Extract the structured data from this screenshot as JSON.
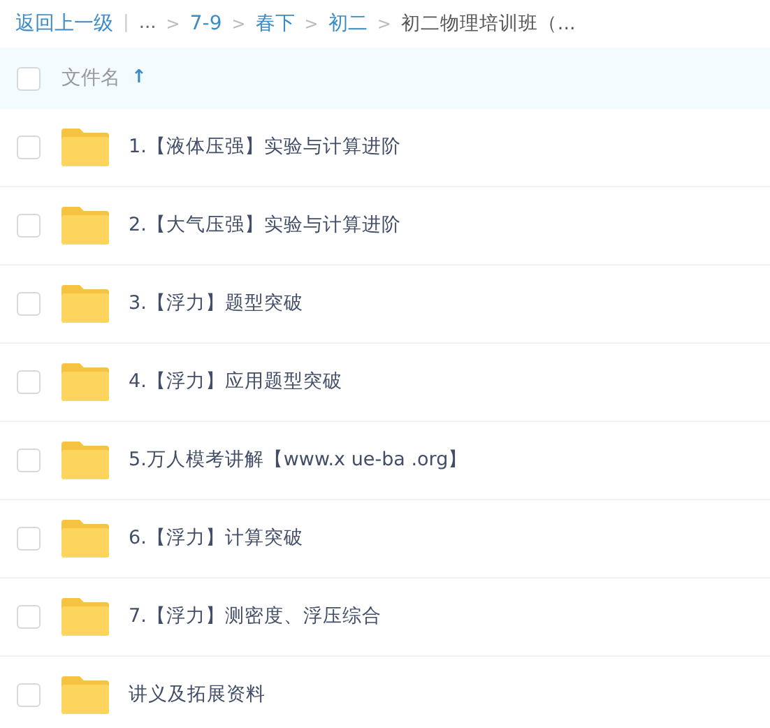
{
  "breadcrumb": [
    {
      "kind": "link",
      "label": "返回上一级"
    },
    {
      "kind": "divider",
      "label": "|"
    },
    {
      "kind": "text",
      "label": "..."
    },
    {
      "kind": "separator",
      "label": ">"
    },
    {
      "kind": "link",
      "label": "7-9"
    },
    {
      "kind": "separator",
      "label": ">"
    },
    {
      "kind": "link",
      "label": "春下"
    },
    {
      "kind": "separator",
      "label": ">"
    },
    {
      "kind": "link",
      "label": "初二"
    },
    {
      "kind": "separator",
      "label": ">"
    },
    {
      "kind": "current",
      "label": "初二物理培训班（..."
    }
  ],
  "header": {
    "checked": false,
    "label": "文件名",
    "sort_icon": "↑"
  },
  "files": [
    {
      "name": "1.【液体压强】实验与计算进阶",
      "checked": false
    },
    {
      "name": "2.【大气压强】实验与计算进阶",
      "checked": false
    },
    {
      "name": "3.【浮力】题型突破",
      "checked": false
    },
    {
      "name": "4.【浮力】应用题型突破",
      "checked": false
    },
    {
      "name": "5.万人模考讲解【www.x ue-ba .org】",
      "checked": false
    },
    {
      "name": "6.【浮力】计算突破",
      "checked": false
    },
    {
      "name": "7.【浮力】测密度、浮压综合",
      "checked": false
    },
    {
      "name": "讲义及拓展资料",
      "checked": false
    }
  ]
}
